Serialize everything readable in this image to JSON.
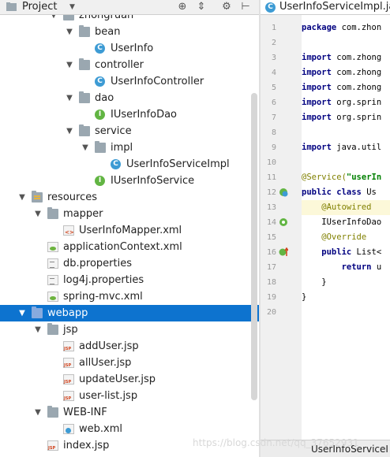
{
  "panel": {
    "title": "Project",
    "caret": "▼",
    "buttons": [
      {
        "name": "target-icon",
        "glyph": "⊕"
      },
      {
        "name": "collapse-all-icon",
        "glyph": "⇕"
      },
      {
        "name": "gear-icon",
        "glyph": "⚙"
      },
      {
        "name": "hide-icon",
        "glyph": "⊢"
      }
    ]
  },
  "tree": [
    {
      "label": "zhongruan",
      "icon": "package",
      "indent": 0,
      "expanded": true,
      "partial": true
    },
    {
      "label": "bean",
      "icon": "package",
      "indent": 1,
      "expanded": true
    },
    {
      "label": "UserInfo",
      "icon": "class",
      "indent": 2
    },
    {
      "label": "controller",
      "icon": "package",
      "indent": 1,
      "expanded": true
    },
    {
      "label": "UserInfoController",
      "icon": "class",
      "indent": 2
    },
    {
      "label": "dao",
      "icon": "package",
      "indent": 1,
      "expanded": true
    },
    {
      "label": "IUserInfoDao",
      "icon": "interface",
      "indent": 2
    },
    {
      "label": "service",
      "icon": "package",
      "indent": 1,
      "expanded": true
    },
    {
      "label": "impl",
      "icon": "package",
      "indent": 2,
      "expanded": true
    },
    {
      "label": "UserInfoServiceImpl",
      "icon": "class",
      "indent": 3
    },
    {
      "label": "IUserInfoService",
      "icon": "interface",
      "indent": 2
    },
    {
      "label": "resources",
      "icon": "resources-folder",
      "indent": -2,
      "expanded": true
    },
    {
      "label": "mapper",
      "icon": "folder",
      "indent": -1,
      "expanded": true
    },
    {
      "label": "UserInfoMapper.xml",
      "icon": "xml",
      "indent": 0
    },
    {
      "label": "applicationContext.xml",
      "icon": "spring-xml",
      "indent": -1
    },
    {
      "label": "db.properties",
      "icon": "properties",
      "indent": -1
    },
    {
      "label": "log4j.properties",
      "icon": "properties",
      "indent": -1
    },
    {
      "label": "spring-mvc.xml",
      "icon": "spring-xml",
      "indent": -1
    },
    {
      "label": "webapp",
      "icon": "web-folder",
      "indent": -2,
      "expanded": true,
      "selected": true
    },
    {
      "label": "jsp",
      "icon": "folder",
      "indent": -1,
      "expanded": true
    },
    {
      "label": "addUser.jsp",
      "icon": "jsp",
      "indent": 0
    },
    {
      "label": "allUser.jsp",
      "icon": "jsp",
      "indent": 0
    },
    {
      "label": "updateUser.jsp",
      "icon": "jsp",
      "indent": 0
    },
    {
      "label": "user-list.jsp",
      "icon": "jsp",
      "indent": 0
    },
    {
      "label": "WEB-INF",
      "icon": "folder",
      "indent": -1,
      "expanded": true
    },
    {
      "label": "web.xml",
      "icon": "web-xml",
      "indent": 0
    },
    {
      "label": "index.jsp",
      "icon": "jsp",
      "indent": -1
    }
  ],
  "editor": {
    "tab": "UserInfoServiceImpl.java",
    "status_text": "UserInfoServiceI",
    "lines": [
      {
        "n": "1",
        "segs": [
          [
            "kw",
            "package "
          ],
          [
            "pk",
            "com.zhon"
          ]
        ]
      },
      {
        "n": "2",
        "segs": []
      },
      {
        "n": "3",
        "segs": [
          [
            "kw",
            "import "
          ],
          [
            "pk",
            "com.zhong"
          ]
        ]
      },
      {
        "n": "4",
        "segs": [
          [
            "kw",
            "import "
          ],
          [
            "pk",
            "com.zhong"
          ]
        ]
      },
      {
        "n": "5",
        "segs": [
          [
            "kw",
            "import "
          ],
          [
            "pk",
            "com.zhong"
          ]
        ]
      },
      {
        "n": "6",
        "segs": [
          [
            "kw",
            "import "
          ],
          [
            "pk",
            "org.sprin"
          ]
        ]
      },
      {
        "n": "7",
        "segs": [
          [
            "kw",
            "import "
          ],
          [
            "pk",
            "org.sprin"
          ]
        ]
      },
      {
        "n": "8",
        "segs": []
      },
      {
        "n": "9",
        "segs": [
          [
            "kw",
            "import "
          ],
          [
            "pk",
            "java.util"
          ]
        ]
      },
      {
        "n": "10",
        "segs": []
      },
      {
        "n": "11",
        "segs": [
          [
            "an",
            "@Service("
          ],
          [
            "st",
            "\"userIn"
          ]
        ]
      },
      {
        "n": "12",
        "segs": [
          [
            "kw",
            "public class "
          ],
          [
            "pk",
            "Us"
          ]
        ]
      },
      {
        "n": "13",
        "segs": [
          [
            "an",
            "    @Autowired"
          ]
        ],
        "highlight": true
      },
      {
        "n": "14",
        "segs": [
          [
            "pk",
            "    IUserInfoDao"
          ]
        ]
      },
      {
        "n": "15",
        "segs": [
          [
            "an",
            "    @Override"
          ]
        ]
      },
      {
        "n": "16",
        "segs": [
          [
            "kw",
            "    public "
          ],
          [
            "pk",
            "List<"
          ]
        ]
      },
      {
        "n": "17",
        "segs": [
          [
            "kw",
            "        return "
          ],
          [
            "pk",
            "u"
          ]
        ]
      },
      {
        "n": "18",
        "segs": [
          [
            "pk",
            "    }"
          ]
        ]
      },
      {
        "n": "19",
        "segs": [
          [
            "pk",
            "}"
          ]
        ]
      },
      {
        "n": "20",
        "segs": []
      }
    ],
    "gutter_marks": [
      {
        "line": 12,
        "icon": "class-impl-icon"
      },
      {
        "line": 14,
        "icon": "bean-injection-icon"
      },
      {
        "line": 16,
        "icon": "implements-method-icon"
      }
    ]
  },
  "watermark": "https://blog.csdn.net/qq_37652931",
  "colors": {
    "selection": "#0d73cf",
    "class": "#3d9bd4",
    "interface": "#62b543"
  }
}
